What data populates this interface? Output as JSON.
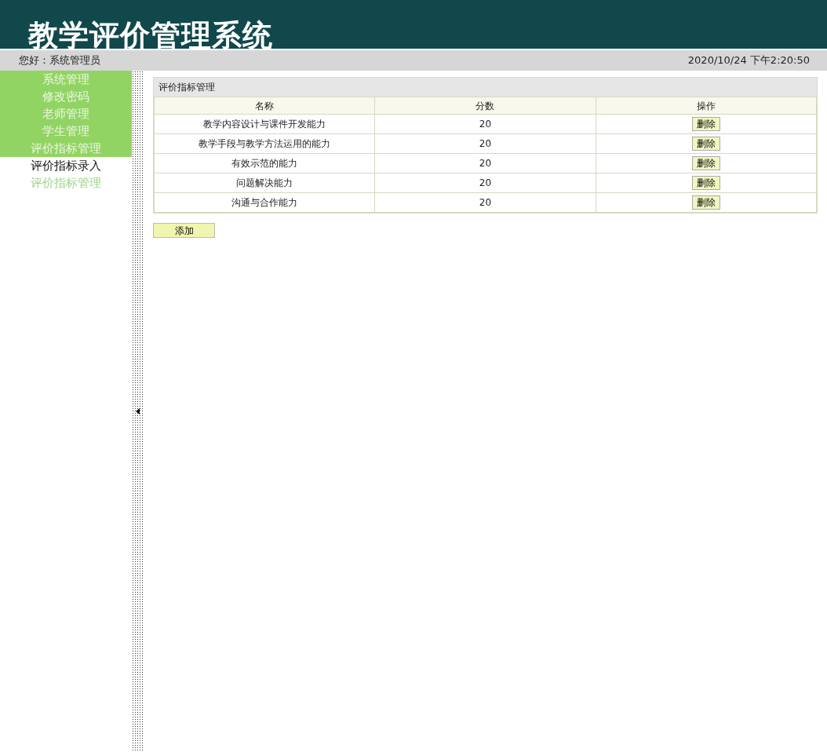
{
  "header": {
    "title": "教学评价管理系统"
  },
  "top_bar": {
    "greeting": "您好：系统管理员",
    "datetime": "2020/10/24 下午2:20:50"
  },
  "sidebar": {
    "items": [
      {
        "label": "系统管理",
        "kind": "group",
        "selected": false
      },
      {
        "label": "修改密码",
        "kind": "group",
        "selected": false
      },
      {
        "label": "老师管理",
        "kind": "group",
        "selected": false
      },
      {
        "label": "学生管理",
        "kind": "group",
        "selected": false
      },
      {
        "label": "评价指标管理",
        "kind": "group",
        "selected": false
      },
      {
        "label": "评价指标录入",
        "kind": "sub",
        "selected": false
      },
      {
        "label": "评价指标管理",
        "kind": "sub",
        "selected": true
      }
    ]
  },
  "panel": {
    "title": "评价指标管理",
    "table": {
      "columns": [
        "名称",
        "分数",
        "操作"
      ],
      "rows": [
        {
          "name": "教学内容设计与课件开发能力",
          "score": "20",
          "action": "删除"
        },
        {
          "name": "教学手段与教学方法运用的能力",
          "score": "20",
          "action": "删除"
        },
        {
          "name": "有效示范的能力",
          "score": "20",
          "action": "删除"
        },
        {
          "name": "问题解决能力",
          "score": "20",
          "action": "删除"
        },
        {
          "name": "沟通与合作能力",
          "score": "20",
          "action": "删除"
        }
      ]
    },
    "add_button": "添加"
  }
}
